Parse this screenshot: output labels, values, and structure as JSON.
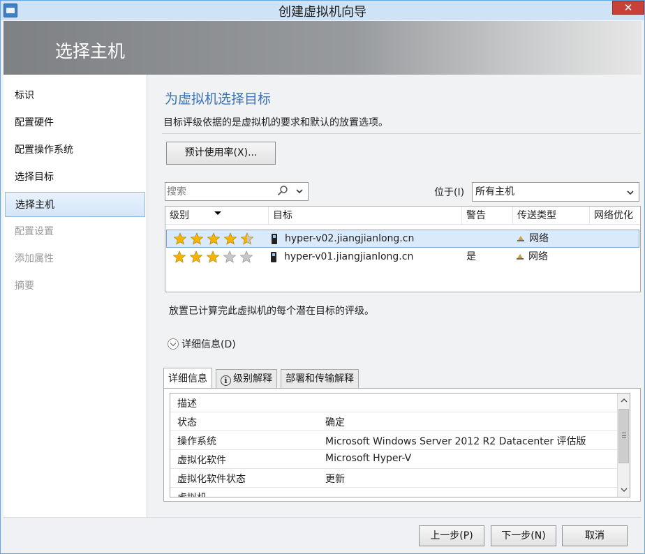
{
  "window": {
    "title": "创建虚拟机向导",
    "close_label": "✕"
  },
  "header": {
    "title": "选择主机"
  },
  "nav": {
    "items": [
      {
        "label": "标识"
      },
      {
        "label": "配置硬件"
      },
      {
        "label": "配置操作系统"
      },
      {
        "label": "选择目标"
      },
      {
        "label": "选择主机"
      },
      {
        "label": "配置设置"
      },
      {
        "label": "添加属性"
      },
      {
        "label": "摘要"
      }
    ],
    "selected_index": 4
  },
  "main": {
    "section_title": "为虚拟机选择目标",
    "section_desc": "目标评级依据的是虚拟机的要求和默认的放置选项。",
    "estimate_button": "预计使用率(X)...",
    "search": {
      "placeholder": "搜索",
      "value": ""
    },
    "location": {
      "label": "位于(I)",
      "value": "所有主机"
    },
    "table": {
      "headers": [
        "级别",
        "目标",
        "警告",
        "传送类型",
        "网络优化"
      ],
      "rows": [
        {
          "rating": 4.5,
          "target": "hyper-v02.jiangjianlong.cn",
          "warning": "",
          "transfer": "网络",
          "network_opt": ""
        },
        {
          "rating": 3,
          "target": "hyper-v01.jiangjianlong.cn",
          "warning": "是",
          "transfer": "网络",
          "network_opt": ""
        }
      ],
      "selected_index": 0
    },
    "placement_text": "放置已计算完此虚拟机的每个潜在目标的评级。",
    "details_toggle": "详细信息(D)",
    "tabs": [
      "详细信息",
      "级别解释",
      "部署和传输解释"
    ],
    "active_tab": 0,
    "details": [
      {
        "key": "描述",
        "value": ""
      },
      {
        "key": "状态",
        "value": "确定"
      },
      {
        "key": "操作系统",
        "value": "Microsoft Windows Server 2012 R2 Datacenter 评估版"
      },
      {
        "key": "虚拟化软件",
        "value": "Microsoft Hyper-V"
      },
      {
        "key": "虚拟化软件状态",
        "value": "更新"
      },
      {
        "key": "虚拟机",
        "value": ""
      }
    ]
  },
  "footer": {
    "prev": "上一步(P)",
    "next": "下一步(N)",
    "cancel": "取消"
  },
  "colors": {
    "accent": "#3a73b5",
    "selection": "#dbeafb",
    "star_fill": "#f4b400",
    "star_empty": "#c8c8c8"
  }
}
